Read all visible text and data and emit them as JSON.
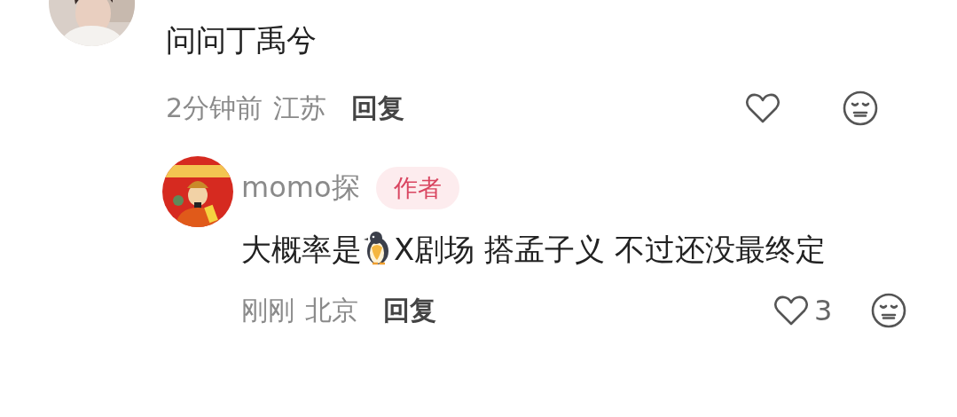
{
  "comment": {
    "text": "问问丁禹兮",
    "time": "2分钟前",
    "location": "江苏",
    "reply_label": "回复"
  },
  "replies": [
    {
      "author": "momo探",
      "badge": "作者",
      "text_parts": [
        {
          "kind": "text",
          "text": "大概率是"
        },
        {
          "kind": "emoji"
        },
        {
          "kind": "text",
          "text": "X剧场 搭孟子义 不过还没最终定"
        }
      ],
      "time": "刚刚",
      "location": "北京",
      "reply_label": "回复",
      "like_count": "3"
    }
  ]
}
